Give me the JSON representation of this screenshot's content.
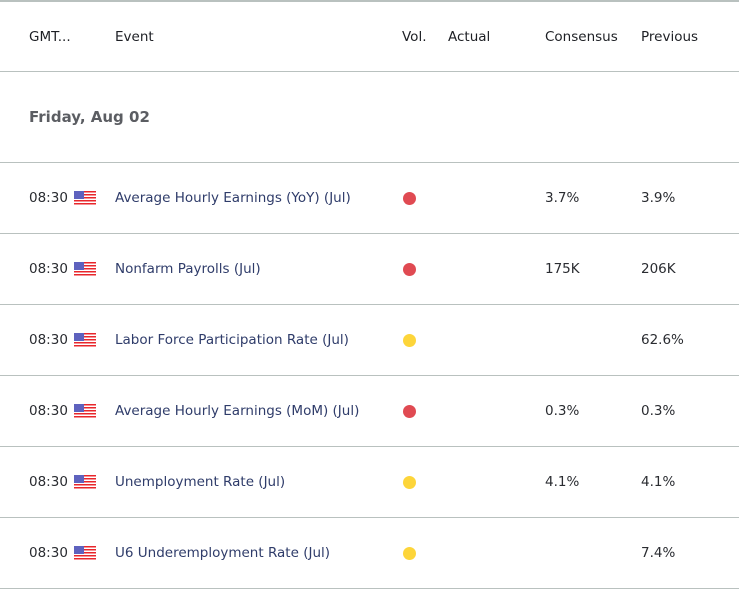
{
  "header": {
    "time": "GMT...",
    "event": "Event",
    "vol": "Vol.",
    "actual": "Actual",
    "consensus": "Consensus",
    "previous": "Previous"
  },
  "date_group": "Friday, Aug 02",
  "colors": {
    "high": "#e04a52",
    "medium": "#fdd53a"
  },
  "rows": [
    {
      "time": "08:30",
      "country": "us-flag",
      "event": "Average Hourly Earnings (YoY) (Jul)",
      "volatility": "high",
      "actual": "",
      "consensus": "3.7%",
      "previous": "3.9%"
    },
    {
      "time": "08:30",
      "country": "us-flag",
      "event": "Nonfarm Payrolls (Jul)",
      "volatility": "high",
      "actual": "",
      "consensus": "175K",
      "previous": "206K"
    },
    {
      "time": "08:30",
      "country": "us-flag",
      "event": "Labor Force Participation Rate (Jul)",
      "volatility": "medium",
      "actual": "",
      "consensus": "",
      "previous": "62.6%"
    },
    {
      "time": "08:30",
      "country": "us-flag",
      "event": "Average Hourly Earnings (MoM) (Jul)",
      "volatility": "high",
      "actual": "",
      "consensus": "0.3%",
      "previous": "0.3%"
    },
    {
      "time": "08:30",
      "country": "us-flag",
      "event": "Unemployment Rate (Jul)",
      "volatility": "medium",
      "actual": "",
      "consensus": "4.1%",
      "previous": "4.1%"
    },
    {
      "time": "08:30",
      "country": "us-flag",
      "event": "U6 Underemployment Rate (Jul)",
      "volatility": "medium",
      "actual": "",
      "consensus": "",
      "previous": "7.4%"
    }
  ]
}
